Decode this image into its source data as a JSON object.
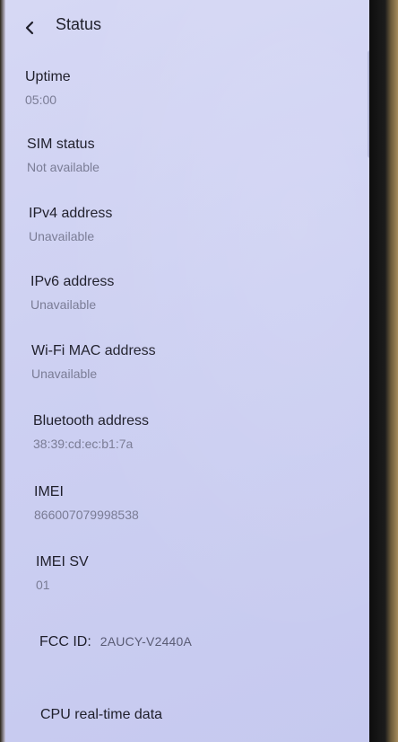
{
  "header": {
    "title": "Status",
    "back_icon": "chevron-left-icon"
  },
  "items": [
    {
      "title": "Uptime",
      "value": "05:00"
    },
    {
      "title": "SIM status",
      "value": "Not available"
    },
    {
      "title": "IPv4 address",
      "value": "Unavailable"
    },
    {
      "title": "IPv6 address",
      "value": "Unavailable"
    },
    {
      "title": "Wi-Fi MAC address",
      "value": "Unavailable"
    },
    {
      "title": "Bluetooth address",
      "value": "38:39:cd:ec:b1:7a"
    },
    {
      "title": "IMEI",
      "value": "866007079998538"
    },
    {
      "title": "IMEI SV",
      "value": "01"
    }
  ],
  "fcc": {
    "label": "FCC ID:",
    "value": "2AUCY-V2440A"
  },
  "footer_item": {
    "title": "CPU real-time data"
  },
  "colors": {
    "screen_bg": "#cdd0f2",
    "text_primary": "#1f1f2b",
    "text_secondary": "#7a7c95"
  }
}
